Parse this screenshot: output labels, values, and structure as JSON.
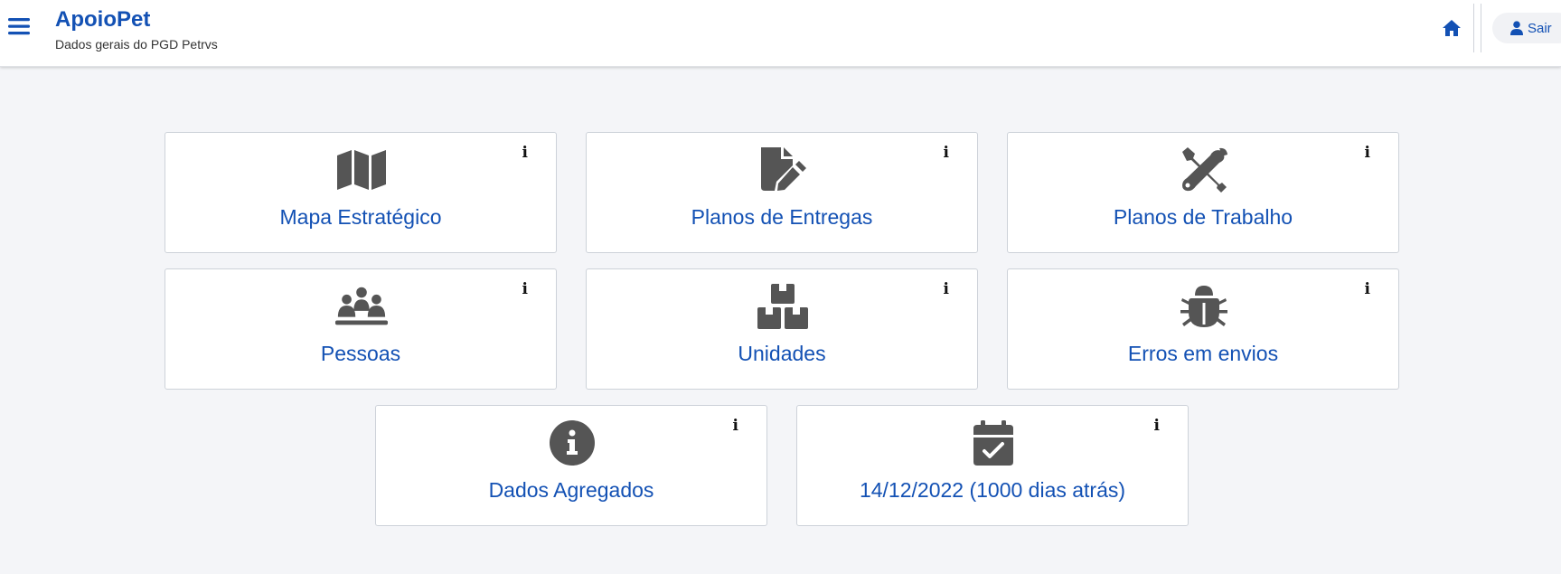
{
  "header": {
    "app_title": "ApoioPet",
    "subtitle": "Dados gerais do PGD Petrvs",
    "menu_icon": "bars-icon",
    "home_icon": "home-icon",
    "logout_label": "Sair",
    "logout_icon": "user-icon"
  },
  "cards": [
    {
      "title": "Mapa Estratégico",
      "icon": "map-icon",
      "info": "i"
    },
    {
      "title": "Planos de Entregas",
      "icon": "file-pen-icon",
      "info": "i"
    },
    {
      "title": "Planos de Trabalho",
      "icon": "tools-icon",
      "info": "i"
    },
    {
      "title": "Pessoas",
      "icon": "people-group-icon",
      "info": "i"
    },
    {
      "title": "Unidades",
      "icon": "boxes-icon",
      "info": "i"
    },
    {
      "title": "Erros em envios",
      "icon": "bug-icon",
      "info": "i"
    },
    {
      "title": "Dados Agregados",
      "icon": "info-circle-icon",
      "info": "i"
    },
    {
      "title": "14/12/2022 (1000 dias atrás)",
      "icon": "calendar-check-icon",
      "info": "i"
    }
  ],
  "colors": {
    "brand": "#1351b4",
    "icon": "#555555",
    "background": "#f4f5f8"
  }
}
